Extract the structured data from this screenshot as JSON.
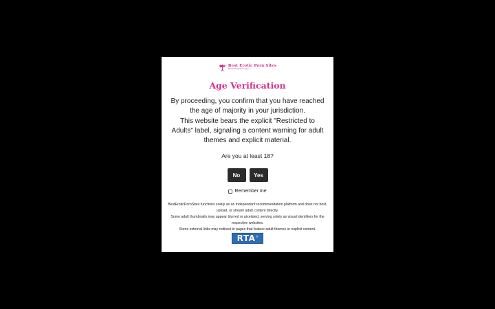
{
  "logo": {
    "title": "Best Erotic Porn Sites",
    "tagline": "Best adult website reviews"
  },
  "modal": {
    "title": "Age Verification",
    "paragraphs": [
      "By proceeding, you confirm that you have reached the age of majority in your jurisdiction.",
      "This website bears the explicit \"Restricted to Adults\" label, signaling a content warning for adult themes and explicit material."
    ],
    "question": "Are you at least 18?",
    "no_label": "No",
    "yes_label": "Yes",
    "remember_label": "Remember me",
    "disclaimer": [
      "BestEroticPornSites functions solely as an independent recommendation platform and does not host, upload, or stream adult content directly.",
      "Some adult thumbnails may appear blurred or pixelated, serving solely as visual identifiers for the respective websites.",
      "Some external links may redirect to pages that feature adult themes or explicit content."
    ]
  },
  "badge": {
    "label": "RTA",
    "mark": "®"
  },
  "colors": {
    "backdrop": "#000000",
    "accent": "#d6308f",
    "button": "#2c2c2c",
    "rta_blue": "#2f6db3"
  }
}
